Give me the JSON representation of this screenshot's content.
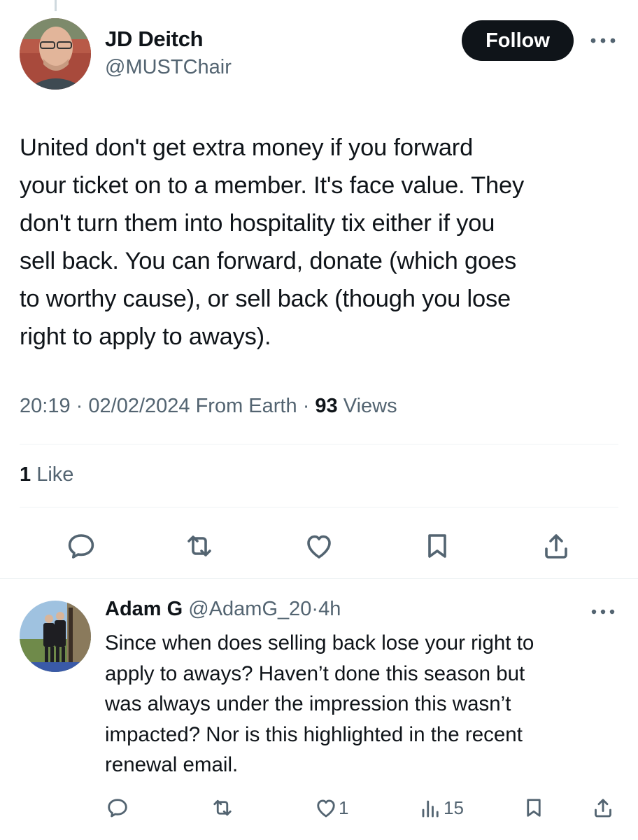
{
  "main_tweet": {
    "author_name": "JD Deitch",
    "author_handle": "@MUSTChair",
    "follow_label": "Follow",
    "text": "United don't get extra money if you forward\nyour ticket on to a member. It's face value. They\ndon't turn them into hospitality tix either if you\nsell back. You can forward, donate (which goes\nto worthy cause), or sell back (though you lose\nright to apply to aways).",
    "time": "20:19",
    "date": "02/02/2024",
    "source": "From Earth",
    "separator": "·",
    "views_count": "93",
    "views_label": "Views",
    "likes_count": "1",
    "likes_label": "Like",
    "actions": [
      "reply-icon",
      "retweet-icon",
      "like-icon",
      "bookmark-icon",
      "share-icon"
    ]
  },
  "reply": {
    "author_name": "Adam G",
    "author_handle": "@AdamG_20",
    "separator": "·",
    "time": "4h",
    "text": "Since when does selling back lose your right to\napply to aways? Haven’t done this season but\nwas always under the impression this wasn’t\nimpacted? Nor is this highlighted in the recent\nrenewal email.",
    "likes_count": "1",
    "views_count": "15"
  },
  "colors": {
    "text_primary": "#0f1419",
    "text_secondary": "#536471",
    "divider": "#eff3f4",
    "follow_bg": "#0f1419",
    "follow_text": "#ffffff"
  }
}
